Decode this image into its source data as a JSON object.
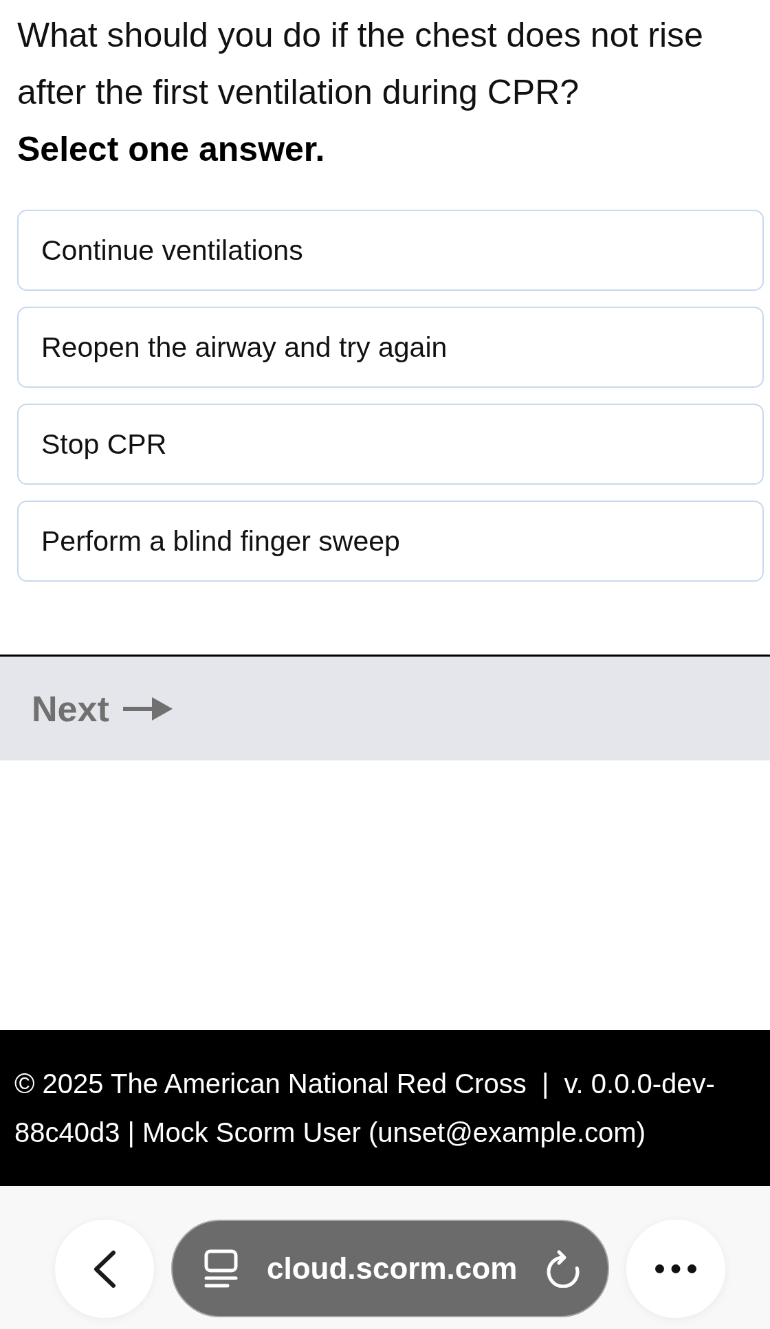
{
  "question": {
    "text": "What should you do if the chest does not rise after the first ventilation during CPR?",
    "instruction": "Select one answer."
  },
  "options": [
    {
      "label": "Continue ventilations",
      "selected": false
    },
    {
      "label": "Reopen the airway and try again",
      "selected": false
    },
    {
      "label": "Stop CPR",
      "selected": false
    },
    {
      "label": "Perform a blind finger sweep",
      "selected": false
    }
  ],
  "next_button": {
    "label": "Next",
    "disabled": true
  },
  "footer": {
    "text": "© 2025 The American National Red Cross  |  v. 0.0.0-dev-88c40d3 | Mock Scorm User (unset@example.com)"
  },
  "browser_bar": {
    "url": "cloud.scorm.com"
  }
}
